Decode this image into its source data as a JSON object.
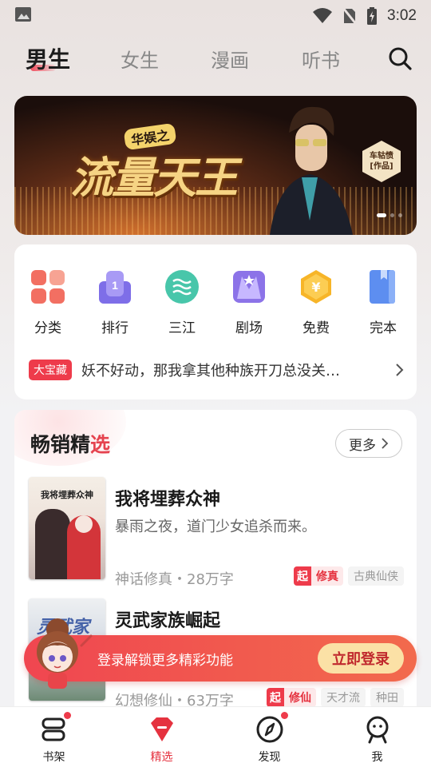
{
  "status_bar": {
    "time": "3:02"
  },
  "top_tabs": [
    {
      "label": "男生",
      "active": true
    },
    {
      "label": "女生",
      "active": false
    },
    {
      "label": "漫画",
      "active": false
    },
    {
      "label": "听书",
      "active": false
    }
  ],
  "banner": {
    "subtitle": "华娱之",
    "title": "流量天王",
    "badge_line1": "车轱愤",
    "badge_line2": "[作品]"
  },
  "categories": [
    {
      "label": "分类",
      "icon": "grid-icon"
    },
    {
      "label": "排行",
      "icon": "ranking-icon"
    },
    {
      "label": "三江",
      "icon": "sanjiang-icon"
    },
    {
      "label": "剧场",
      "icon": "theater-icon"
    },
    {
      "label": "免费",
      "icon": "free-icon"
    },
    {
      "label": "完本",
      "icon": "book-complete-icon"
    }
  ],
  "treasure": {
    "badge": "大宝藏",
    "text": "妖不好动，那我拿其他种族开刀总没关…"
  },
  "bestseller": {
    "title_part1": "畅销精",
    "title_part2": "选",
    "more_label": "更多",
    "books": [
      {
        "cover_title": "我将埋葬众神",
        "title": "我将埋葬众神",
        "desc": "暴雨之夜，道门少女追杀而来。",
        "meta": "神话修真・28万字",
        "tag_prefix": "起",
        "tag_main": "修真",
        "tags": [
          "古典仙侠"
        ]
      },
      {
        "cover_title": "灵武家",
        "title": "灵武家族崛起",
        "desc": "",
        "meta": "幻想修仙・63万字",
        "tag_prefix": "起",
        "tag_main": "修仙",
        "tags": [
          "天才流",
          "种田"
        ]
      }
    ]
  },
  "login_banner": {
    "text": "登录解锁更多精彩功能",
    "button": "立即登录"
  },
  "bottom_nav": [
    {
      "label": "书架",
      "active": false,
      "dot": true
    },
    {
      "label": "精选",
      "active": true,
      "dot": false
    },
    {
      "label": "发现",
      "active": false,
      "dot": true
    },
    {
      "label": "我",
      "active": false,
      "dot": false
    }
  ],
  "colors": {
    "accent": "#e5323f",
    "login_gradient_start": "#f04650",
    "login_button": "#fbe1a6"
  }
}
